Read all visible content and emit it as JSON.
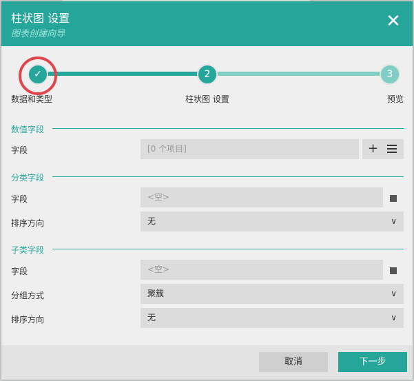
{
  "header": {
    "title": "柱状图 设置",
    "subtitle": "图表创建向导"
  },
  "steps": [
    {
      "number": "",
      "label": "数据和类型",
      "state": "done"
    },
    {
      "number": "2",
      "label": "柱状图 设置",
      "state": "current"
    },
    {
      "number": "3",
      "label": "预览",
      "state": "pending"
    }
  ],
  "value_section": {
    "title": "数值字段",
    "field_label": "字段",
    "field_value": "[0 个项目]"
  },
  "category_section": {
    "title": "分类字段",
    "field_label": "字段",
    "field_placeholder": "<空>",
    "sort_label": "排序方向",
    "sort_value": "无"
  },
  "subcategory_section": {
    "title": "子类字段",
    "field_label": "字段",
    "field_placeholder": "<空>",
    "group_label": "分组方式",
    "group_value": "聚簇",
    "sort_label": "排序方向",
    "sort_value": "无"
  },
  "footer": {
    "cancel_label": "取消",
    "next_label": "下一步"
  },
  "colors": {
    "accent": "#26a59a",
    "accent_light": "#7fcdc4",
    "highlight_ring": "#e0454b"
  }
}
